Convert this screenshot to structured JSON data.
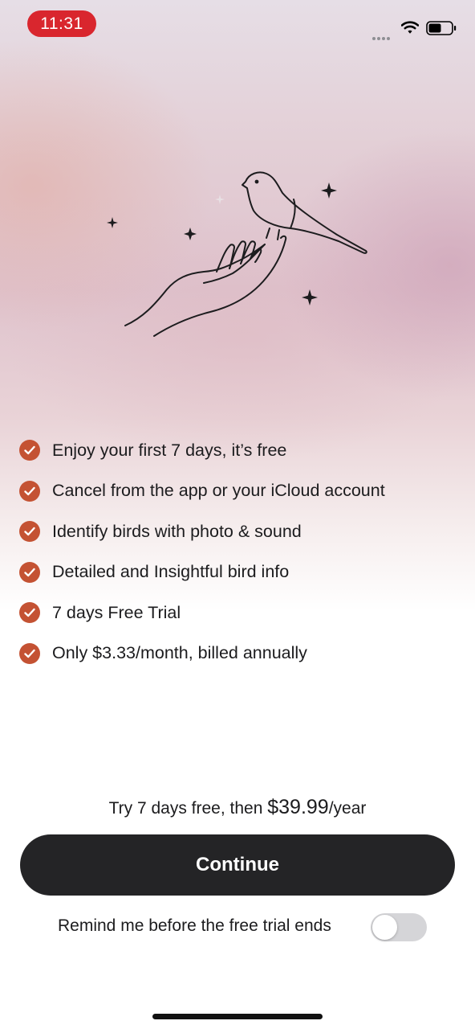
{
  "status_bar": {
    "time": "11:31"
  },
  "illustration": {
    "icon": "hand-holding-bird-icon"
  },
  "features": [
    {
      "text": "Enjoy your first 7 days, it’s free"
    },
    {
      "text": "Cancel from the app or your iCloud account"
    },
    {
      "text": "Identify birds with photo & sound"
    },
    {
      "text": "Detailed and Insightful bird info"
    },
    {
      "text": "7 days Free Trial"
    },
    {
      "text": "Only $3.33/month, billed annually"
    }
  ],
  "pricing": {
    "prefix": "Try 7 days free, then ",
    "amount": "$39.99",
    "suffix": "/year"
  },
  "continue_label": "Continue",
  "reminder": {
    "label": "Remind me before the free trial ends",
    "enabled": false
  },
  "colors": {
    "accent": "#c45233",
    "button": "#242426",
    "time_pill": "#d9262e"
  }
}
